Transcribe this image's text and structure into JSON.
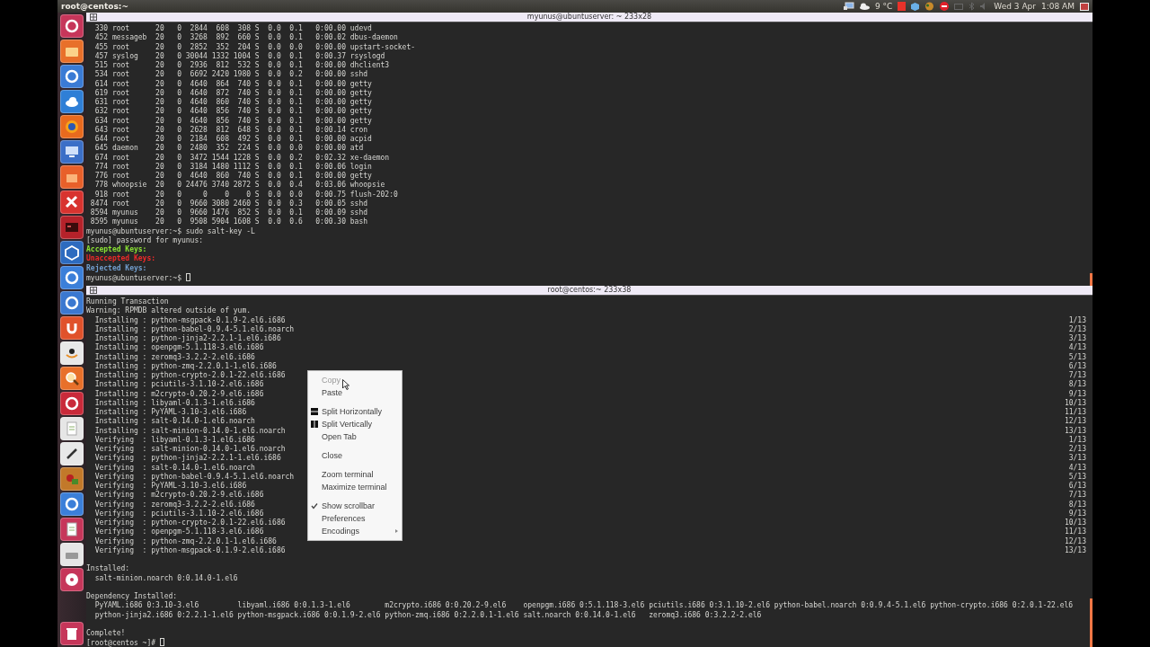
{
  "panel": {
    "title": "root@centos:~",
    "temperature": "9 °C",
    "date": "Wed 3 Apr",
    "time": "1:08 AM"
  },
  "top_terminal": {
    "title": "myunus@ubuntuserver: ~ 233x28",
    "lines": [
      {
        "kind": "text",
        "text": "  330 root      20   0  2844  608  308 S  0.0  0.1   0:00.00 udevd"
      },
      {
        "kind": "text",
        "text": "  452 messageb  20   0  3268  892  660 S  0.0  0.1   0:00.02 dbus-daemon"
      },
      {
        "kind": "text",
        "text": "  455 root      20   0  2852  352  204 S  0.0  0.0   0:00.00 upstart-socket-"
      },
      {
        "kind": "text",
        "text": "  457 syslog    20   0 30044 1332 1004 S  0.0  0.1   0:00.37 rsyslogd"
      },
      {
        "kind": "text",
        "text": "  515 root      20   0  2936  812  532 S  0.0  0.1   0:00.00 dhclient3"
      },
      {
        "kind": "text",
        "text": "  534 root      20   0  6692 2420 1980 S  0.0  0.2   0:00.00 sshd"
      },
      {
        "kind": "text",
        "text": "  614 root      20   0  4640  864  740 S  0.0  0.1   0:00.00 getty"
      },
      {
        "kind": "text",
        "text": "  619 root      20   0  4640  872  740 S  0.0  0.1   0:00.00 getty"
      },
      {
        "kind": "text",
        "text": "  631 root      20   0  4640  860  740 S  0.0  0.1   0:00.00 getty"
      },
      {
        "kind": "text",
        "text": "  632 root      20   0  4640  856  740 S  0.0  0.1   0:00.00 getty"
      },
      {
        "kind": "text",
        "text": "  634 root      20   0  4640  856  740 S  0.0  0.1   0:00.00 getty"
      },
      {
        "kind": "text",
        "text": "  643 root      20   0  2628  812  648 S  0.0  0.1   0:00.14 cron"
      },
      {
        "kind": "text",
        "text": "  644 root      20   0  2184  608  492 S  0.0  0.1   0:00.00 acpid"
      },
      {
        "kind": "text",
        "text": "  645 daemon    20   0  2480  352  224 S  0.0  0.0   0:00.00 atd"
      },
      {
        "kind": "text",
        "text": "  674 root      20   0  3472 1544 1228 S  0.0  0.2   0:02.32 xe-daemon"
      },
      {
        "kind": "text",
        "text": "  774 root      20   0  3184 1480 1112 S  0.0  0.1   0:00.06 login"
      },
      {
        "kind": "text",
        "text": "  776 root      20   0  4640  860  740 S  0.0  0.1   0:00.00 getty"
      },
      {
        "kind": "text",
        "text": "  778 whoopsie  20   0 24476 3740 2872 S  0.0  0.4   0:03.06 whoopsie"
      },
      {
        "kind": "text",
        "text": "  918 root      20   0     0    0    0 S  0.0  0.0   0:00.75 flush-202:0"
      },
      {
        "kind": "text",
        "text": " 8474 root      20   0  9660 3080 2460 S  0.0  0.3   0:00.05 sshd"
      },
      {
        "kind": "text",
        "text": " 8594 myunus    20   0  9660 1476  852 S  0.0  0.1   0:00.09 sshd"
      },
      {
        "kind": "text",
        "text": " 8595 myunus    20   0  9508 5904 1608 S  0.0  0.6   0:00.30 bash"
      },
      {
        "kind": "text",
        "text": "myunus@ubuntuserver:~$ sudo salt-key -L"
      },
      {
        "kind": "text",
        "text": "[sudo] password for myunus:"
      },
      {
        "kind": "text",
        "text": "Accepted Keys:",
        "color": "#8ae234"
      },
      {
        "kind": "text",
        "text": "Unaccepted Keys:",
        "color": "#ef2929"
      },
      {
        "kind": "text",
        "text": "Rejected Keys:",
        "color": "#729fcf"
      }
    ],
    "prompt": {
      "text": "myunus@ubuntuserver:~$ ",
      "cursor": true
    }
  },
  "bottom_terminal": {
    "title": "root@centos:~ 233x38",
    "lines": [
      {
        "kind": "text",
        "text": "Running Transaction"
      },
      {
        "kind": "text",
        "text": "Warning: RPMDB altered outside of yum."
      },
      {
        "kind": "text",
        "text": "  Installing : python-msgpack-0.1.9-2.el6.i686",
        "count": "1/13"
      },
      {
        "kind": "text",
        "text": "  Installing : python-babel-0.9.4-5.1.el6.noarch",
        "count": "2/13"
      },
      {
        "kind": "text",
        "text": "  Installing : python-jinja2-2.2.1-1.el6.i686",
        "count": "3/13"
      },
      {
        "kind": "text",
        "text": "  Installing : openpgm-5.1.118-3.el6.i686",
        "count": "4/13"
      },
      {
        "kind": "text",
        "text": "  Installing : zeromq3-3.2.2-2.el6.i686",
        "count": "5/13"
      },
      {
        "kind": "text",
        "text": "  Installing : python-zmq-2.2.0.1-1.el6.i686",
        "count": "6/13"
      },
      {
        "kind": "text",
        "text": "  Installing : python-crypto-2.0.1-22.el6.i686",
        "count": "7/13"
      },
      {
        "kind": "text",
        "text": "  Installing : pciutils-3.1.10-2.el6.i686",
        "count": "8/13"
      },
      {
        "kind": "text",
        "text": "  Installing : m2crypto-0.20.2-9.el6.i686",
        "count": "9/13"
      },
      {
        "kind": "text",
        "text": "  Installing : libyaml-0.1.3-1.el6.i686",
        "count": "10/13"
      },
      {
        "kind": "text",
        "text": "  Installing : PyYAML-3.10-3.el6.i686",
        "count": "11/13"
      },
      {
        "kind": "text",
        "text": "  Installing : salt-0.14.0-1.el6.noarch",
        "count": "12/13"
      },
      {
        "kind": "text",
        "text": "  Installing : salt-minion-0.14.0-1.el6.noarch",
        "count": "13/13"
      },
      {
        "kind": "text",
        "text": "  Verifying  : libyaml-0.1.3-1.el6.i686",
        "count": "1/13"
      },
      {
        "kind": "text",
        "text": "  Verifying  : salt-minion-0.14.0-1.el6.noarch",
        "count": "2/13"
      },
      {
        "kind": "text",
        "text": "  Verifying  : python-jinja2-2.2.1-1.el6.i686",
        "count": "3/13"
      },
      {
        "kind": "text",
        "text": "  Verifying  : salt-0.14.0-1.el6.noarch",
        "count": "4/13"
      },
      {
        "kind": "text",
        "text": "  Verifying  : python-babel-0.9.4-5.1.el6.noarch",
        "count": "5/13"
      },
      {
        "kind": "text",
        "text": "  Verifying  : PyYAML-3.10-3.el6.i686",
        "count": "6/13"
      },
      {
        "kind": "text",
        "text": "  Verifying  : m2crypto-0.20.2-9.el6.i686",
        "count": "7/13"
      },
      {
        "kind": "text",
        "text": "  Verifying  : zeromq3-3.2.2-2.el6.i686",
        "count": "8/13"
      },
      {
        "kind": "text",
        "text": "  Verifying  : pciutils-3.1.10-2.el6.i686",
        "count": "9/13"
      },
      {
        "kind": "text",
        "text": "  Verifying  : python-crypto-2.0.1-22.el6.i686",
        "count": "10/13"
      },
      {
        "kind": "text",
        "text": "  Verifying  : openpgm-5.1.118-3.el6.i686",
        "count": "11/13"
      },
      {
        "kind": "text",
        "text": "  Verifying  : python-zmq-2.2.0.1-1.el6.i686",
        "count": "12/13"
      },
      {
        "kind": "text",
        "text": "  Verifying  : python-msgpack-0.1.9-2.el6.i686",
        "count": "13/13"
      },
      {
        "kind": "blank"
      },
      {
        "kind": "text",
        "text": "Installed:"
      },
      {
        "kind": "text",
        "text": "  salt-minion.noarch 0:0.14.0-1.el6"
      },
      {
        "kind": "blank"
      },
      {
        "kind": "text",
        "text": "Dependency Installed:"
      },
      {
        "kind": "text",
        "text": "  PyYAML.i686 0:3.10-3.el6         libyaml.i686 0:0.1.3-1.el6        m2crypto.i686 0:0.20.2-9.el6    openpgm.i686 0:5.1.118-3.el6 pciutils.i686 0:3.1.10-2.el6 python-babel.noarch 0:0.9.4-5.1.el6 python-crypto.i686 0:2.0.1-22.el6"
      },
      {
        "kind": "text",
        "text": "  python-jinja2.i686 0:2.2.1-1.el6 python-msgpack.i686 0:0.1.9-2.el6 python-zmq.i686 0:2.2.0.1-1.el6 salt.noarch 0:0.14.0-1.el6   zeromq3.i686 0:3.2.2-2.el6"
      },
      {
        "kind": "blank"
      },
      {
        "kind": "text",
        "text": "Complete!"
      }
    ],
    "prompt": {
      "text": "[root@centos ~]# ",
      "cursor": true
    }
  },
  "context_menu": {
    "items": [
      {
        "kind": "plain",
        "label": "Copy",
        "disabled": true,
        "checked": false
      },
      {
        "kind": "plain",
        "label": "Paste",
        "disabled": false,
        "checked": false
      },
      {
        "kind": "separator"
      },
      {
        "kind": "split-horizontal",
        "label": "Split Horizontally",
        "disabled": false,
        "checked": false
      },
      {
        "kind": "split-vertical",
        "label": "Split Vertically",
        "disabled": false,
        "checked": false
      },
      {
        "kind": "plain",
        "label": "Open Tab",
        "disabled": false,
        "checked": false
      },
      {
        "kind": "separator"
      },
      {
        "kind": "plain",
        "label": "Close",
        "disabled": false,
        "checked": false
      },
      {
        "kind": "separator"
      },
      {
        "kind": "plain",
        "label": "Zoom terminal",
        "disabled": false,
        "checked": false
      },
      {
        "kind": "plain",
        "label": "Maximize terminal",
        "disabled": false,
        "checked": false
      },
      {
        "kind": "separator"
      },
      {
        "kind": "plain",
        "label": "Show scrollbar",
        "disabled": false,
        "checked": true
      },
      {
        "kind": "plain",
        "label": "Preferences",
        "disabled": false,
        "checked": false
      },
      {
        "kind": "submenu",
        "label": "Encodings",
        "disabled": false,
        "checked": false
      }
    ]
  }
}
